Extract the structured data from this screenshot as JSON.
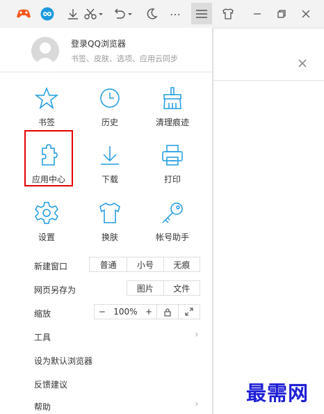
{
  "toolbar": {
    "icons": [
      "game-icon",
      "infinity-icon",
      "download-icon",
      "scissors-icon",
      "undo-icon",
      "moon-icon",
      "more-icon",
      "menu-icon",
      "skin-icon",
      "minimize-icon",
      "restore-icon",
      "close-icon"
    ],
    "more_label": "⋯",
    "accent": "#f25a1e",
    "brand_blue": "#1d9be0"
  },
  "account": {
    "login": "登录QQ浏览器",
    "sync": "书签、皮肤、选项、应用云同步"
  },
  "grid": [
    {
      "label": "书签",
      "icon": "star-icon"
    },
    {
      "label": "历史",
      "icon": "clock-icon"
    },
    {
      "label": "清理痕迹",
      "icon": "broom-icon"
    },
    {
      "label": "应用中心",
      "icon": "puzzle-icon"
    },
    {
      "label": "下载",
      "icon": "download-icon"
    },
    {
      "label": "打印",
      "icon": "printer-icon"
    },
    {
      "label": "设置",
      "icon": "gear-icon"
    },
    {
      "label": "换肤",
      "icon": "tshirt-icon"
    },
    {
      "label": "帐号助手",
      "icon": "key-icon"
    }
  ],
  "rows": {
    "new_window": {
      "label": "新建窗口",
      "options": [
        "普通",
        "小号",
        "无痕"
      ]
    },
    "save_as": {
      "label": "网页另存为",
      "options": [
        "图片",
        "文件"
      ]
    },
    "zoom": {
      "label": "缩放",
      "minus": "−",
      "value": "100%",
      "plus": "+"
    },
    "tools": "工具",
    "default_browser": "设为默认浏览器",
    "feedback": "反馈建议",
    "help": "帮助"
  },
  "watermark": "最需网"
}
